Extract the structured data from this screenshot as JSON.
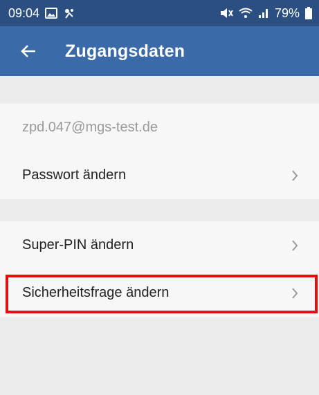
{
  "status_bar": {
    "time": "09:04",
    "battery": "79%",
    "icons": [
      "image-icon",
      "notification-icon",
      "mute-icon",
      "wifi-icon",
      "signal-icon",
      "battery-icon"
    ]
  },
  "app_bar": {
    "back_icon": "arrow-left-icon",
    "title": "Zugangsdaten"
  },
  "section1": {
    "email": "zpd.047@mgs-test.de",
    "items": [
      {
        "label": "Passwort ändern",
        "icon": "chevron-right-icon"
      }
    ]
  },
  "section2": {
    "items": [
      {
        "label": "Super-PIN ändern",
        "icon": "chevron-right-icon"
      },
      {
        "label": "Sicherheitsfrage ändern",
        "icon": "chevron-right-icon"
      }
    ]
  },
  "colors": {
    "status_bar": "#2a4f80",
    "app_bar": "#3a6aa8",
    "background": "#ececec",
    "row_background": "#f7f7f7",
    "highlight": "#e01010"
  }
}
